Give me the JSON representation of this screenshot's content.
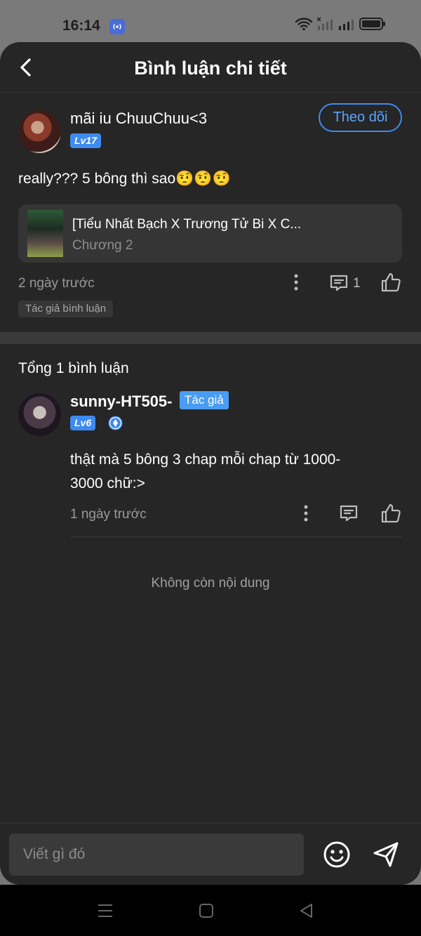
{
  "status_bar": {
    "time": "16:14"
  },
  "header": {
    "title": "Bình luận chi tiết"
  },
  "main_comment": {
    "username": "mãi iu ChuuChuu<3",
    "level": "Lv17",
    "follow_label": "Theo dõi",
    "text": "really??? 5 bông thì sao🤨🤨🤨",
    "story": {
      "title": "[Tiểu Nhất Bạch X Trương Tử Bi X C...",
      "chapter": "Chương 2"
    },
    "time": "2 ngày trước",
    "reply_count": "1",
    "tag": "Tác giả bình luận"
  },
  "replies_section": {
    "total_label": "Tổng 1 bình luận",
    "end_label": "Không còn nội dung"
  },
  "reply": {
    "username": "sunny-HT505-",
    "author_badge": "Tác giả",
    "level": "Lv6",
    "text": "thật mà 5 bông 3 chap mỗi chap từ 1000-3000 chữ:>",
    "time": "1 ngày trước"
  },
  "composer": {
    "placeholder": "Viết gì đó"
  },
  "colors": {
    "accent": "#3d8af0",
    "background": "#262626",
    "card": "#353535"
  }
}
